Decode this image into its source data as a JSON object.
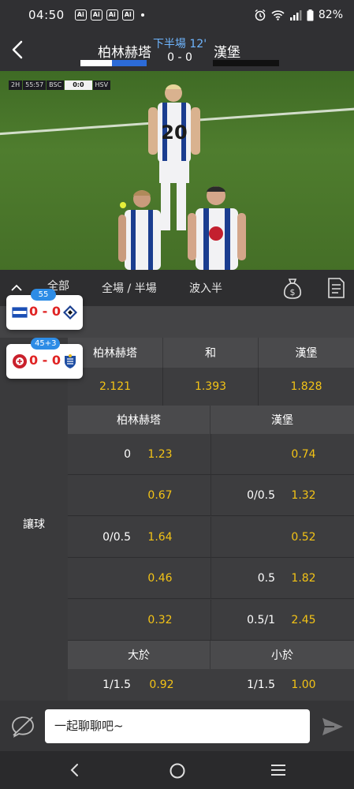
{
  "status_bar": {
    "time": "04:50",
    "ai_badges": [
      "Ai",
      "Ai",
      "Ai",
      "Ai"
    ],
    "battery": "82%"
  },
  "header": {
    "home_team": "柏林赫塔",
    "away_team": "漢堡",
    "period": "下半場 12'",
    "score": "0 - 0"
  },
  "video": {
    "scorebug_tag": "2H",
    "scorebug_clock": "55:57",
    "scorebug_home": "BSC",
    "scorebug_score": "0:0",
    "scorebug_away": "HSV",
    "jersey_number": "20"
  },
  "tabs": {
    "all": "全部",
    "full_half": "全場 / 半場",
    "second_half": "波入半"
  },
  "match_cards": [
    {
      "minute": "55",
      "score": "0 - 0"
    },
    {
      "minute": "45+3",
      "score": "0 - 0"
    }
  ],
  "odds_1x2": {
    "headers": [
      "柏林赫塔",
      "和",
      "漢堡"
    ],
    "values": [
      "2.121",
      "1.393",
      "1.828"
    ]
  },
  "handicap": {
    "label": "讓球",
    "home_header": "柏林赫塔",
    "away_header": "漢堡",
    "rows": [
      {
        "home_line": "0",
        "home_odds": "1.23",
        "away_line": "",
        "away_odds": "0.74"
      },
      {
        "home_line": "",
        "home_odds": "0.67",
        "away_line": "0/0.5",
        "away_odds": "1.32"
      },
      {
        "home_line": "0/0.5",
        "home_odds": "1.64",
        "away_line": "",
        "away_odds": "0.52"
      },
      {
        "home_line": "",
        "home_odds": "0.46",
        "away_line": "0.5",
        "away_odds": "1.82"
      },
      {
        "home_line": "",
        "home_odds": "0.32",
        "away_line": "0.5/1",
        "away_odds": "2.45"
      }
    ]
  },
  "totals": {
    "over_header": "大於",
    "under_header": "小於",
    "rows": [
      {
        "over_line": "1/1.5",
        "over_odds": "0.92",
        "under_line": "1/1.5",
        "under_odds": "1.00"
      }
    ]
  },
  "chat": {
    "placeholder": "一起聊聊吧~"
  },
  "colors": {
    "accent_blue": "#2d8ce6",
    "odds_yellow": "#f3c316",
    "score_red": "#e02424"
  }
}
